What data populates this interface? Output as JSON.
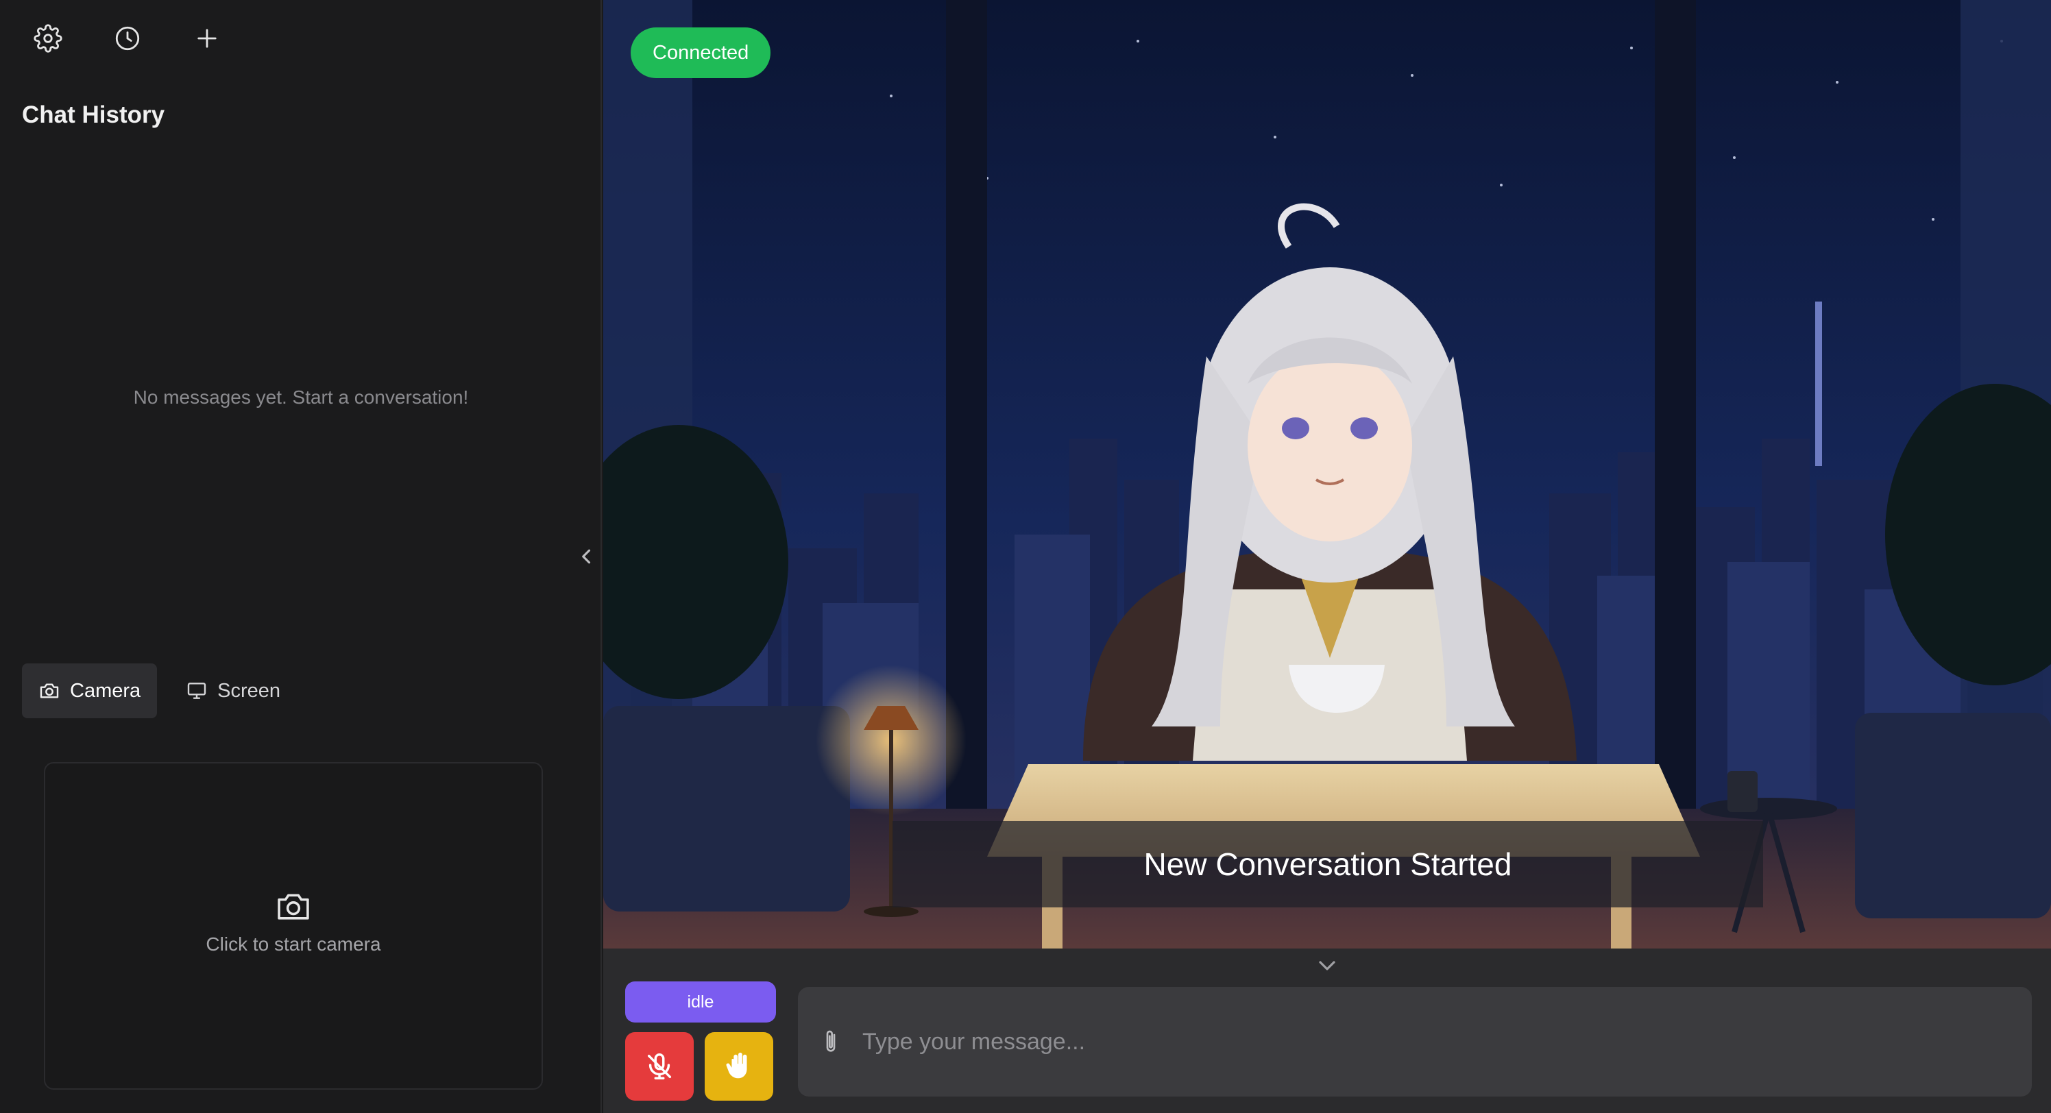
{
  "sidebar": {
    "icons": [
      "gear-icon",
      "history-clock-icon",
      "plus-icon"
    ],
    "title": "Chat History",
    "empty_message": "No messages yet. Start a conversation!",
    "media_tabs": [
      {
        "label": "Camera",
        "icon": "camera-icon",
        "active": true
      },
      {
        "label": "Screen",
        "icon": "monitor-icon",
        "active": false
      }
    ],
    "camera_prompt": "Click to start camera"
  },
  "stage": {
    "connection_status": "Connected",
    "subtitle": "New Conversation Started"
  },
  "controls": {
    "state": "idle",
    "mic_icon": "mic-off-icon",
    "interrupt_icon": "hand-icon",
    "message_placeholder": "Type your message...",
    "attach_icon": "paperclip-icon"
  },
  "colors": {
    "connected": "#1fbb57",
    "state_pill": "#7b5cf0",
    "mic_off": "#e53b3c",
    "interrupt": "#e6b310"
  }
}
